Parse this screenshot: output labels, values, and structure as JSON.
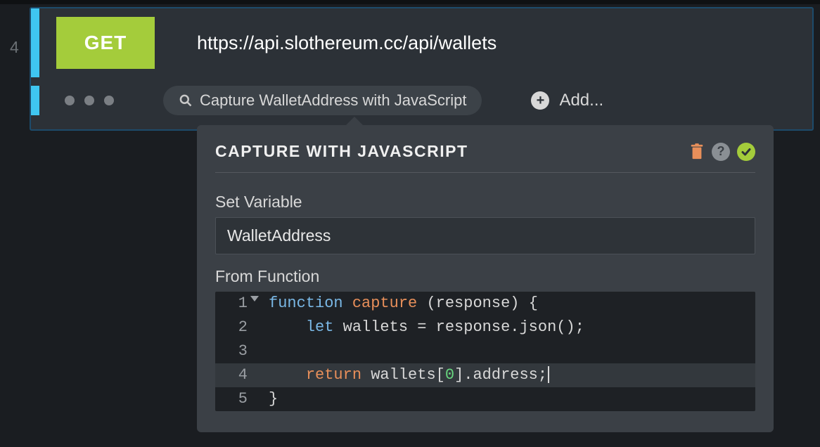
{
  "step_number": "4",
  "request": {
    "method": "GET",
    "url": "https://api.slothereum.cc/api/wallets"
  },
  "chip": {
    "label": "Capture WalletAddress with JavaScript"
  },
  "add": {
    "label": "Add..."
  },
  "panel": {
    "title": "CAPTURE WITH JAVASCRIPT",
    "set_variable_label": "Set Variable",
    "variable_name": "WalletAddress",
    "from_function_label": "From Function",
    "code": {
      "lines": [
        {
          "n": "1",
          "tokens": [
            "function",
            " ",
            "capture",
            " ",
            "(",
            "response",
            ")",
            " ",
            "{"
          ]
        },
        {
          "n": "2",
          "tokens": [
            "    ",
            "let",
            " ",
            "wallets",
            " ",
            "=",
            " ",
            "response",
            ".",
            "json",
            "(",
            ")",
            ";"
          ]
        },
        {
          "n": "3",
          "tokens": [
            ""
          ]
        },
        {
          "n": "4",
          "tokens": [
            "    ",
            "return",
            " ",
            "wallets",
            "[",
            "0",
            "]",
            ".",
            "address",
            ";"
          ],
          "highlight": true,
          "cursor": true
        },
        {
          "n": "5",
          "tokens": [
            "}"
          ]
        }
      ]
    }
  }
}
